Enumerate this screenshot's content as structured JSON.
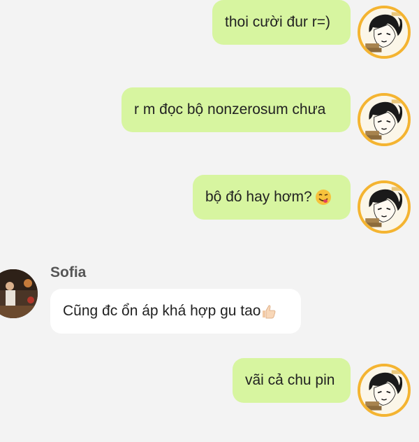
{
  "messages": [
    {
      "text": "thoi cười đur r=)",
      "emoji": ""
    },
    {
      "text": "r m đọc bộ nonzerosum chưa",
      "emoji": ""
    },
    {
      "text": "bộ đó hay hơm? ",
      "emoji": "face-savoring-food-icon"
    },
    {
      "sender": "Sofia",
      "text": "Cũng đc ổn áp khá hợp gu tao",
      "emoji": "thumbs-up-icon"
    },
    {
      "text": "vãi cả chu pin",
      "emoji": ""
    }
  ],
  "colors": {
    "outgoing_bubble": "#d7f5a0",
    "incoming_bubble": "#ffffff",
    "avatar_ring": "#f4b431",
    "background": "#f3f3f3"
  }
}
